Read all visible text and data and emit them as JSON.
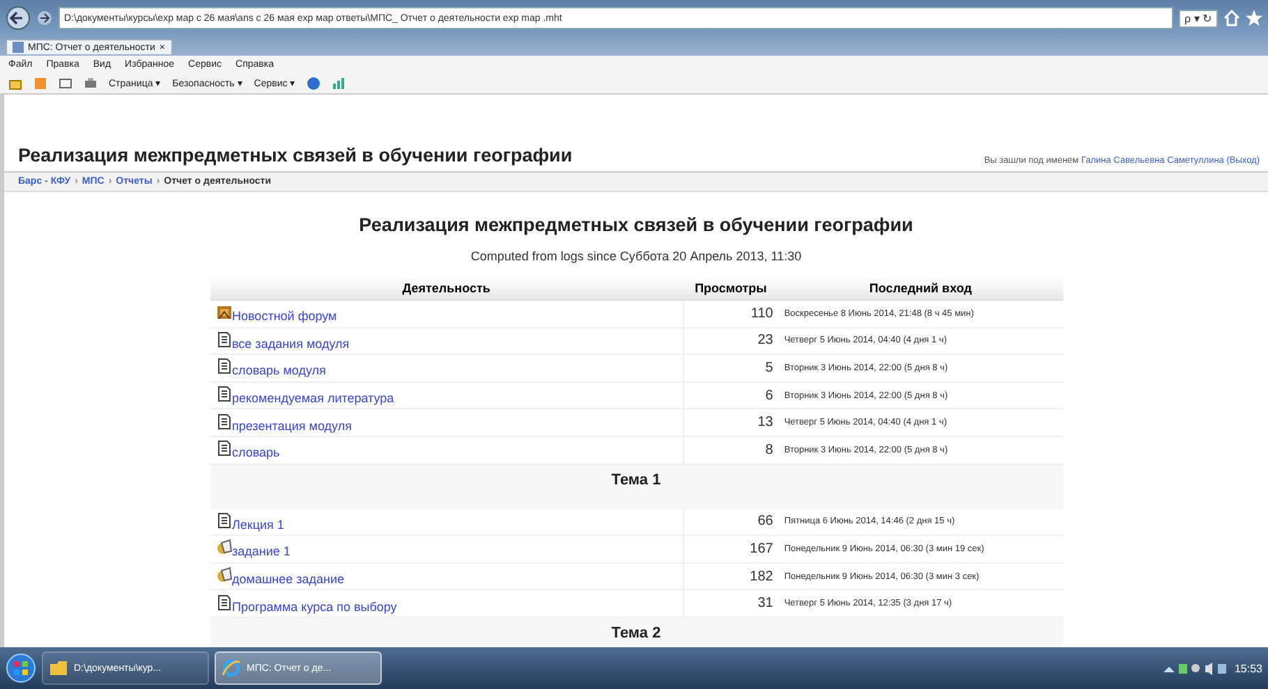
{
  "browser": {
    "address": "D:\\документы\\курсы\\exp мар с 26 мая\\ans с 26 мая exp мар ответы\\МПС_ Отчет о деятельности exp map .mht",
    "search": "ρ ▾ ↻",
    "tab": {
      "label": "МПС: Отчет о деятельности",
      "close": "×"
    },
    "menu": [
      "Файл",
      "Правка",
      "Вид",
      "Избранное",
      "Сервис",
      "Справка"
    ],
    "commands": [
      "Страница ▾",
      "Безопасность ▾",
      "Сервис ▾"
    ]
  },
  "page": {
    "title": "Реализация межпредметных связей в обучении географии",
    "login": {
      "prefix": "Вы зашли под именем",
      "user": "Галина Савельевна Саметуллина",
      "logout": "(Выход)"
    },
    "breadcrumb": [
      {
        "label": "Барс - КФУ",
        "link": true
      },
      {
        "label": "МПС",
        "link": true
      },
      {
        "label": "Отчеты",
        "link": true
      },
      {
        "label": "Отчет о деятельности",
        "link": false
      }
    ],
    "separator": "›"
  },
  "report": {
    "title": "Реализация межпредметных связей в обучении географии",
    "subtitle": "Computed from logs since Суббота 20 Апрель 2013, 11:30",
    "columns": [
      "Деятельность",
      "Просмотры",
      "Последний вход"
    ],
    "rows": [
      {
        "kind": "forum",
        "name": "Новостной форум",
        "views": "110",
        "last": "Воскресенье 8 Июнь 2014, 21:48 (8 ч 45 мин)"
      },
      {
        "kind": "page",
        "name": "все задания модуля",
        "views": "23",
        "last": "Четверг 5 Июнь 2014, 04:40 (4 дня 1 ч)"
      },
      {
        "kind": "page",
        "name": "словарь модуля",
        "views": "5",
        "last": "Вторник 3 Июнь 2014, 22:00 (5 дня 8 ч)"
      },
      {
        "kind": "page",
        "name": "рекомендуемая литература",
        "views": "6",
        "last": "Вторник 3 Июнь 2014, 22:00 (5 дня 8 ч)"
      },
      {
        "kind": "page",
        "name": "презентация модуля",
        "views": "13",
        "last": "Четверг 5 Июнь 2014, 04:40 (4 дня 1 ч)"
      },
      {
        "kind": "page",
        "name": "словарь",
        "views": "8",
        "last": "Вторник 3 Июнь 2014, 22:00 (5 дня 8 ч)"
      },
      {
        "kind": "section",
        "name": "Тема 1"
      },
      {
        "kind": "page",
        "name": "Лекция 1",
        "views": "66",
        "last": "Пятница 6 Июнь 2014, 14:46 (2 дня 15 ч)"
      },
      {
        "kind": "assignment",
        "name": "задание 1",
        "views": "167",
        "last": "Понедельник 9 Июнь 2014, 06:30 (3 мин 19 сек)"
      },
      {
        "kind": "assignment",
        "name": "домашнее задание",
        "views": "182",
        "last": "Понедельник 9 Июнь 2014, 06:30 (3 мин 3 сек)"
      },
      {
        "kind": "page",
        "name": "Программа курса по выбору",
        "views": "31",
        "last": "Четверг 5 Июнь 2014, 12:35 (3 дня 17 ч)"
      },
      {
        "kind": "section",
        "name": "Тема 2"
      }
    ]
  },
  "taskbar": {
    "items": [
      {
        "kind": "folder",
        "label": "D:\\документы\\кур...",
        "selected": false
      },
      {
        "kind": "browser",
        "label": "МПС: Отчет о де...",
        "selected": true
      }
    ],
    "clock": "15:53"
  }
}
